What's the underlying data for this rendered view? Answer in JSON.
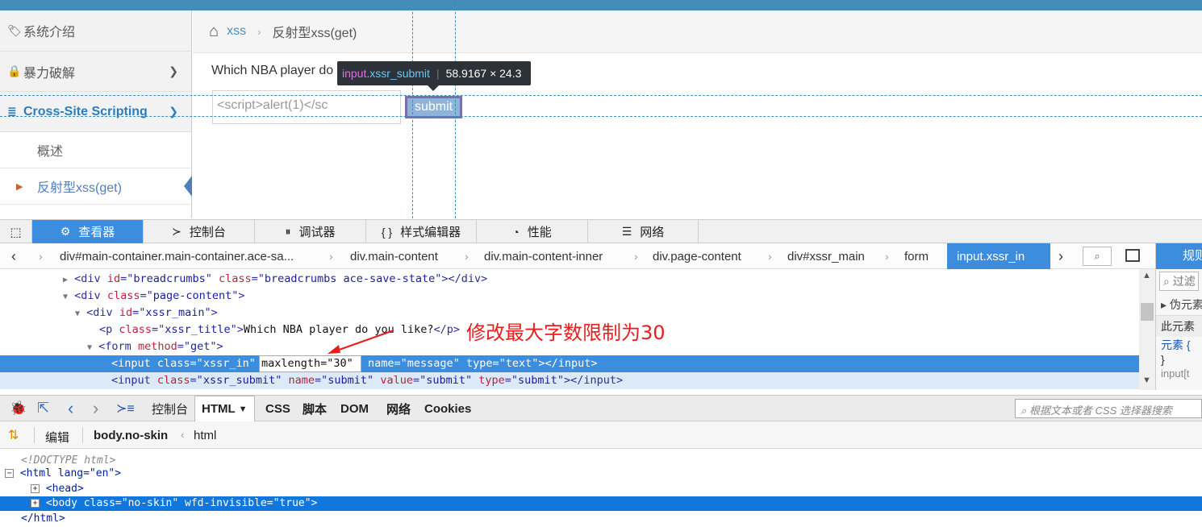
{
  "sidebar": {
    "items": [
      {
        "label": "系统介绍"
      },
      {
        "label": "暴力破解"
      },
      {
        "label": "Cross-Site Scripting"
      }
    ],
    "subitems": [
      {
        "label": "概述"
      },
      {
        "label": "反射型xss(get)"
      }
    ]
  },
  "breadcrumb": {
    "link": "xss",
    "current": "反射型xss(get)"
  },
  "page": {
    "title": "Which NBA player do you like?",
    "title_visible": "Which NBA player do",
    "input_value": "<script>alert(1)</sc",
    "submit_label": "submit"
  },
  "tooltip": {
    "selector_tag": "input",
    "selector_class": ".xssr_submit",
    "size": "58.9167 × 24.3"
  },
  "devtools": {
    "tabs": [
      "查看器",
      "控制台",
      "调试器",
      "样式编辑器",
      "性能",
      "网络"
    ],
    "crumbs": [
      "div#main-container.main-container.ace-sa...",
      "div.main-content",
      "div.main-content-inner",
      "div.page-content",
      "div#xssr_main",
      "form",
      "input.xssr_in"
    ],
    "right_tab": "规则",
    "right_filter": "过滤",
    "right_pseudo": "伪元素",
    "right_this": "此元素",
    "right_elem": "元素 {",
    "right_close": "}",
    "right_input": "input[t"
  },
  "markup": {
    "l1": [
      "<div ",
      "id",
      "=\"",
      "breadcrumbs",
      "\" ",
      "class",
      "=\"",
      "breadcrumbs ace-save-state",
      "\"></div>"
    ],
    "l2": [
      "<div ",
      "class",
      "=\"",
      "page-content",
      "\">"
    ],
    "l3": [
      "<div ",
      "id",
      "=\"",
      "xssr_main",
      "\">"
    ],
    "l4": [
      "<p ",
      "class",
      "=\"",
      "xssr_title",
      "\">",
      "Which NBA player do you like?",
      "</p>"
    ],
    "l5": [
      "<form ",
      "method",
      "=\"",
      "get",
      "\">"
    ],
    "l6a": [
      "<input ",
      "class",
      "=\"",
      "xssr_in",
      "\" "
    ],
    "l6box": "maxlength=\"30\"",
    "l6b": [
      " name",
      "=\"",
      "message",
      "\" ",
      "type",
      "=\"",
      "text",
      "\"></input>"
    ],
    "l7": [
      "<input ",
      "class",
      "=\"",
      "xssr_submit",
      "\" ",
      "name",
      "=\"",
      "submit",
      "\" ",
      "value",
      "=\"",
      "submit",
      "\" ",
      "type",
      "=\"",
      "submit",
      "\"></input>"
    ]
  },
  "annotation": "修改最大字数限制为30",
  "firebug": {
    "tabs": [
      "控制台",
      "HTML",
      "CSS",
      "脚本",
      "DOM",
      "网络",
      "Cookies"
    ],
    "search_placeholder": "根据文本或者 CSS 选择器搜索",
    "edit": "编辑",
    "crumb1": "body.no-skin",
    "crumb2": "html",
    "tree": {
      "doctype": "<!DOCTYPE html>",
      "html_open": "<html  lang=\"en\">",
      "head": "<head>",
      "body": "<body  class=\"no-skin\"  wfd-invisible=\"true\">",
      "html_close": "</html>"
    }
  }
}
